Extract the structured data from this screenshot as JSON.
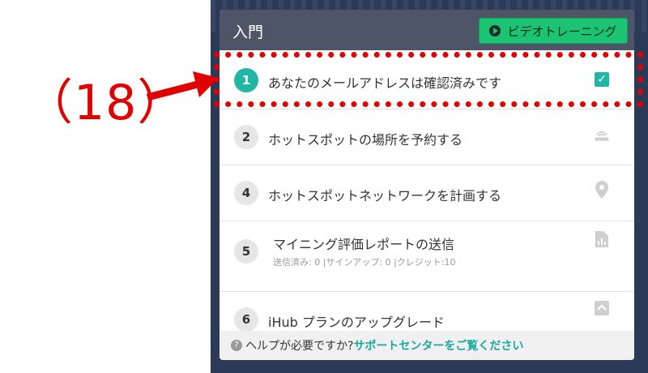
{
  "annotation": {
    "label": "（18）"
  },
  "panel": {
    "title": "入門",
    "video_button": "ビデオトレーニング"
  },
  "steps": [
    {
      "number": "1",
      "label": "あなたのメールアドレスは確認済みです",
      "completed": true,
      "icon": "check-icon"
    },
    {
      "number": "2",
      "label": "ホットスポットの場所を予約する",
      "icon": "hotspot-icon"
    },
    {
      "number": "4",
      "label": "ホットスポットネットワークを計画する",
      "icon": "map-pin-icon"
    },
    {
      "number": "5",
      "label": "マイニング評価レポートの送信",
      "sub": "送信済み: 0 |サインアップ: 0 |クレジット:10",
      "icon": "report-icon"
    },
    {
      "number": "6",
      "label": "iHub プランのアップグレード",
      "icon": "upgrade-icon"
    }
  ],
  "footer": {
    "question": "ヘルプが必要ですか?",
    "link": "サポートセンターをご覧ください"
  },
  "colors": {
    "header": "#4d5566",
    "accent_green": "#1bc473",
    "teal": "#23b5a4",
    "annotation_red": "#e00000"
  }
}
